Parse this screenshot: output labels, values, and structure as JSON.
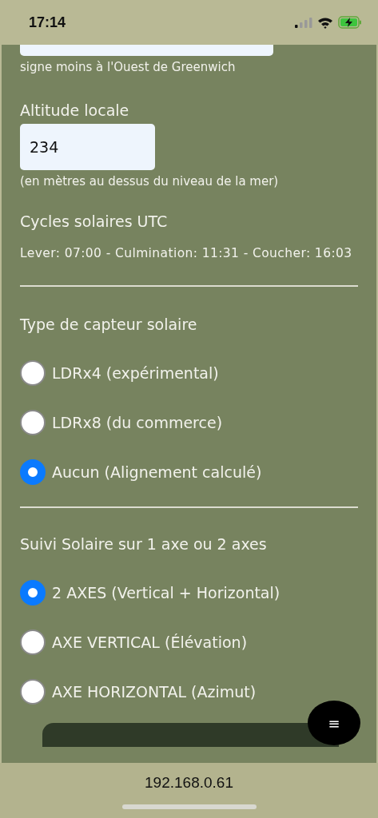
{
  "status_bar": {
    "time": "17:14"
  },
  "longitude": {
    "hint": "signe moins à l'Ouest de Greenwich"
  },
  "altitude": {
    "label": "Altitude locale",
    "value": "234",
    "hint": "(en mètres au dessus du niveau de la mer)"
  },
  "solar_cycles": {
    "title": "Cycles solaires UTC",
    "text": "Lever: 07:00 - Culmination: 11:31 - Coucher: 16:03"
  },
  "sensor_type": {
    "title": "Type de capteur solaire",
    "options": [
      {
        "label": "LDRx4 (expérimental)",
        "selected": false
      },
      {
        "label": "LDRx8 (du commerce)",
        "selected": false
      },
      {
        "label": "Aucun (Alignement calculé)",
        "selected": true
      }
    ]
  },
  "tracking": {
    "title": "Suivi Solaire sur 1 axe ou 2 axes",
    "options": [
      {
        "label": "2 AXES (Vertical + Horizontal)",
        "selected": true
      },
      {
        "label": "AXE VERTICAL (Élévation)",
        "selected": false
      },
      {
        "label": "AXE HORIZONTAL (Azimut)",
        "selected": false
      }
    ]
  },
  "menu_button": {
    "label": "≡"
  },
  "browser_bar": {
    "url": "192.168.0.61"
  }
}
